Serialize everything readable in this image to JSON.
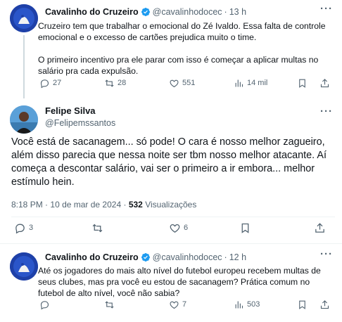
{
  "tweet1": {
    "name": "Cavalinho do Cruzeiro",
    "handle": "@cavalinhodocec",
    "time": "13 h",
    "text": "Cruzeiro tem que trabalhar o emocional do Zé Ivaldo. Essa falta de controle emocional e o excesso de cartões prejudica muito o time.\n\nO primeiro incentivo pra ele parar com isso é começar a aplicar multas no salário pra cada expulsão.",
    "replies": "27",
    "reposts": "28",
    "likes": "551",
    "views": "14 mil"
  },
  "main": {
    "name": "Felipe Silva",
    "handle": "@Felipemssantos",
    "text": "Você está de sacanagem... só pode! O cara é nosso melhor zagueiro, além disso parecia que nessa noite ser tbm nosso melhor atacante. Aí começa a descontar salário, vai ser o primeiro a ir embora... melhor estímulo hein.",
    "time": "8:18 PM",
    "date": "10 de mar de 2024",
    "views_count": "532",
    "views_label": "Visualizações",
    "replies": "3",
    "reposts": "",
    "likes": "6"
  },
  "tweet3": {
    "name": "Cavalinho do Cruzeiro",
    "handle": "@cavalinhodocec",
    "time": "12 h",
    "text": "Até os jogadores do mais alto nível do futebol europeu recebem multas de seus clubes, mas pra você eu estou de sacanagem? Prática comum no futebol de alto nível, você não sabia?",
    "replies": "",
    "reposts": "",
    "likes": "7",
    "views": "503"
  },
  "icons": [
    "more-icon",
    "verified-icon",
    "reply-icon",
    "repost-icon",
    "like-icon",
    "views-icon",
    "bookmark-icon",
    "share-icon"
  ],
  "colors": {
    "text": "#0f1419",
    "muted": "#536471",
    "verified": "#1d9bf0",
    "divider": "#eff3f4"
  }
}
